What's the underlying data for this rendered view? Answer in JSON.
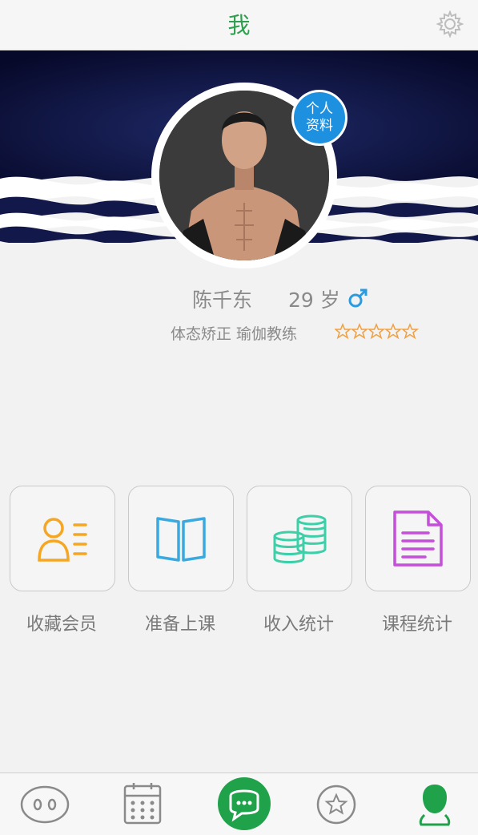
{
  "header": {
    "title": "我",
    "settings_icon": "gear-icon"
  },
  "profile": {
    "badge_line1": "个人",
    "badge_line2": "资料",
    "name": "陈千东",
    "age_number": "29",
    "age_unit": "岁",
    "gender_icon": "male-icon",
    "tags": "体态矫正  瑜伽教练",
    "rating_stars": 5,
    "rating_max": 5
  },
  "tiles": [
    {
      "label": "收藏会员",
      "icon": "members-icon",
      "color": "#f5a623"
    },
    {
      "label": "准备上课",
      "icon": "book-icon",
      "color": "#3aa9e0"
    },
    {
      "label": "收入统计",
      "icon": "coins-icon",
      "color": "#3ccfa8"
    },
    {
      "label": "课程统计",
      "icon": "document-icon",
      "color": "#c44fd8"
    }
  ],
  "tabbar": {
    "items": [
      "eyes-icon",
      "calendar-icon",
      "chat-icon",
      "star-icon",
      "profile-icon"
    ],
    "active_color": "#1fa24a",
    "inactive_color": "#8a8a8a"
  }
}
